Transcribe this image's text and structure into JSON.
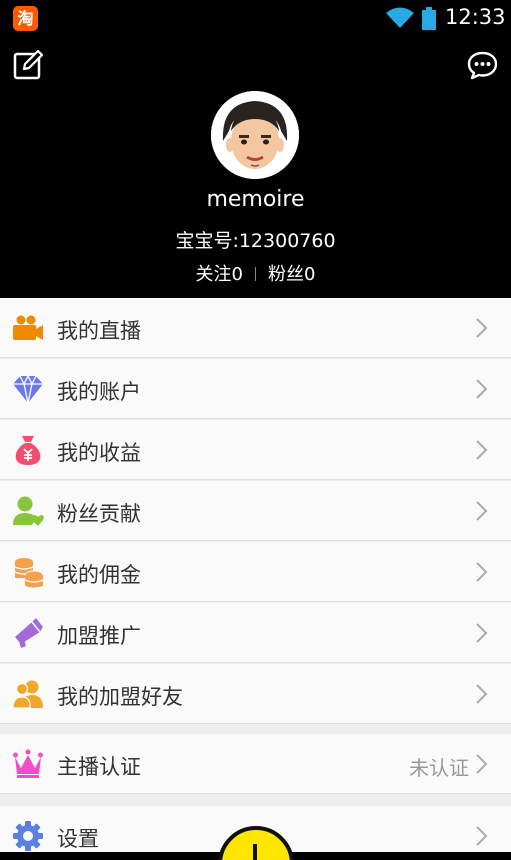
{
  "status_bar": {
    "app_badge": "淘",
    "time": "12:33"
  },
  "profile": {
    "username": "memoire",
    "baby_id": "宝宝号:12300760",
    "following": "关注0",
    "followers": "粉丝0"
  },
  "menu": {
    "items": [
      {
        "label": "我的直播",
        "icon": "video-camera-icon"
      },
      {
        "label": "我的账户",
        "icon": "diamond-icon"
      },
      {
        "label": "我的收益",
        "icon": "money-bag-icon"
      },
      {
        "label": "粉丝贡献",
        "icon": "user-heart-icon"
      },
      {
        "label": "我的佣金",
        "icon": "coins-icon"
      },
      {
        "label": "加盟推广",
        "icon": "megaphone-icon"
      },
      {
        "label": "我的加盟好友",
        "icon": "friends-icon"
      }
    ],
    "certification": {
      "label": "主播认证",
      "status": "未认证",
      "icon": "crown-icon"
    },
    "settings": {
      "label": "设置",
      "icon": "gear-icon"
    }
  },
  "colors": {
    "camera": "#f08a00",
    "diamond": "#6a7ae8",
    "bag": "#f0506e",
    "user": "#8ac43c",
    "coins": "#f4a04c",
    "megaphone": "#a36bd8",
    "friends": "#f4a62a",
    "crown": "#f04ec8",
    "gear": "#5a7fe0"
  }
}
